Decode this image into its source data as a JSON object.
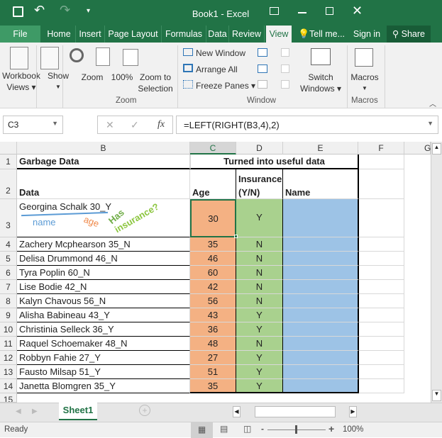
{
  "window": {
    "title": "Book1 - Excel"
  },
  "tabs": [
    "File",
    "Home",
    "Insert",
    "Page Layout",
    "Formulas",
    "Data",
    "Review",
    "View"
  ],
  "tell_me": "Tell me...",
  "sign_in": "Sign in",
  "share": "Share",
  "ribbon": {
    "workbook_views": [
      "Workbook",
      "Views ▾"
    ],
    "show": "Show",
    "zoom": "Zoom",
    "zoom100": "100%",
    "zoom_sel": [
      "Zoom to",
      "Selection"
    ],
    "new_window": "New Window",
    "arrange_all": "Arrange All",
    "freeze_panes": "Freeze Panes ▾",
    "switch_windows": [
      "Switch",
      "Windows ▾"
    ],
    "macros": "Macros",
    "groups": {
      "zoom": "Zoom",
      "window": "Window",
      "macros": "Macros"
    }
  },
  "formula": {
    "name_box": "C3",
    "fx": "fx",
    "value": "=LEFT(RIGHT(B3,4),2)"
  },
  "columns": [
    "B",
    "C",
    "D",
    "E",
    "F",
    "G"
  ],
  "sheet": {
    "b1": "Garbage Data",
    "c1": "Turned into useful data",
    "b2": "Data",
    "c2": "Age",
    "d2a": "Insurance",
    "d2b": "(Y/N)",
    "e2": "Name",
    "annotations": {
      "name": "name",
      "age": "age",
      "has": "Has",
      "insurance": "insurance?"
    },
    "rows": [
      {
        "n": "3",
        "data": "Georgina Schalk 30_Y",
        "age": "30",
        "ins": "Y"
      },
      {
        "n": "4",
        "data": "Zachery Mcphearson 35_N",
        "age": "35",
        "ins": "N"
      },
      {
        "n": "5",
        "data": "Delisa Drummond 46_N",
        "age": "46",
        "ins": "N"
      },
      {
        "n": "6",
        "data": "Tyra Poplin 60_N",
        "age": "60",
        "ins": "N"
      },
      {
        "n": "7",
        "data": "Lise Bodie 42_N",
        "age": "42",
        "ins": "N"
      },
      {
        "n": "8",
        "data": "Kalyn Chavous 56_N",
        "age": "56",
        "ins": "N"
      },
      {
        "n": "9",
        "data": "Alisha Babineau 43_Y",
        "age": "43",
        "ins": "Y"
      },
      {
        "n": "10",
        "data": "Christinia Selleck 36_Y",
        "age": "36",
        "ins": "Y"
      },
      {
        "n": "11",
        "data": "Raquel Schoemaker 48_N",
        "age": "48",
        "ins": "N"
      },
      {
        "n": "12",
        "data": "Robbyn Fahie 27_Y",
        "age": "27",
        "ins": "Y"
      },
      {
        "n": "13",
        "data": "Fausto Milsap 51_Y",
        "age": "51",
        "ins": "Y"
      },
      {
        "n": "14",
        "data": "Janetta Blomgren 35_Y",
        "age": "35",
        "ins": "Y"
      }
    ]
  },
  "sheet_tab": "Sheet1",
  "status": {
    "ready": "Ready",
    "zoom": "100%"
  },
  "colors": {
    "green": "#217346",
    "age": "#f4b183",
    "ins": "#a9d18e",
    "name": "#9dc3e6"
  }
}
